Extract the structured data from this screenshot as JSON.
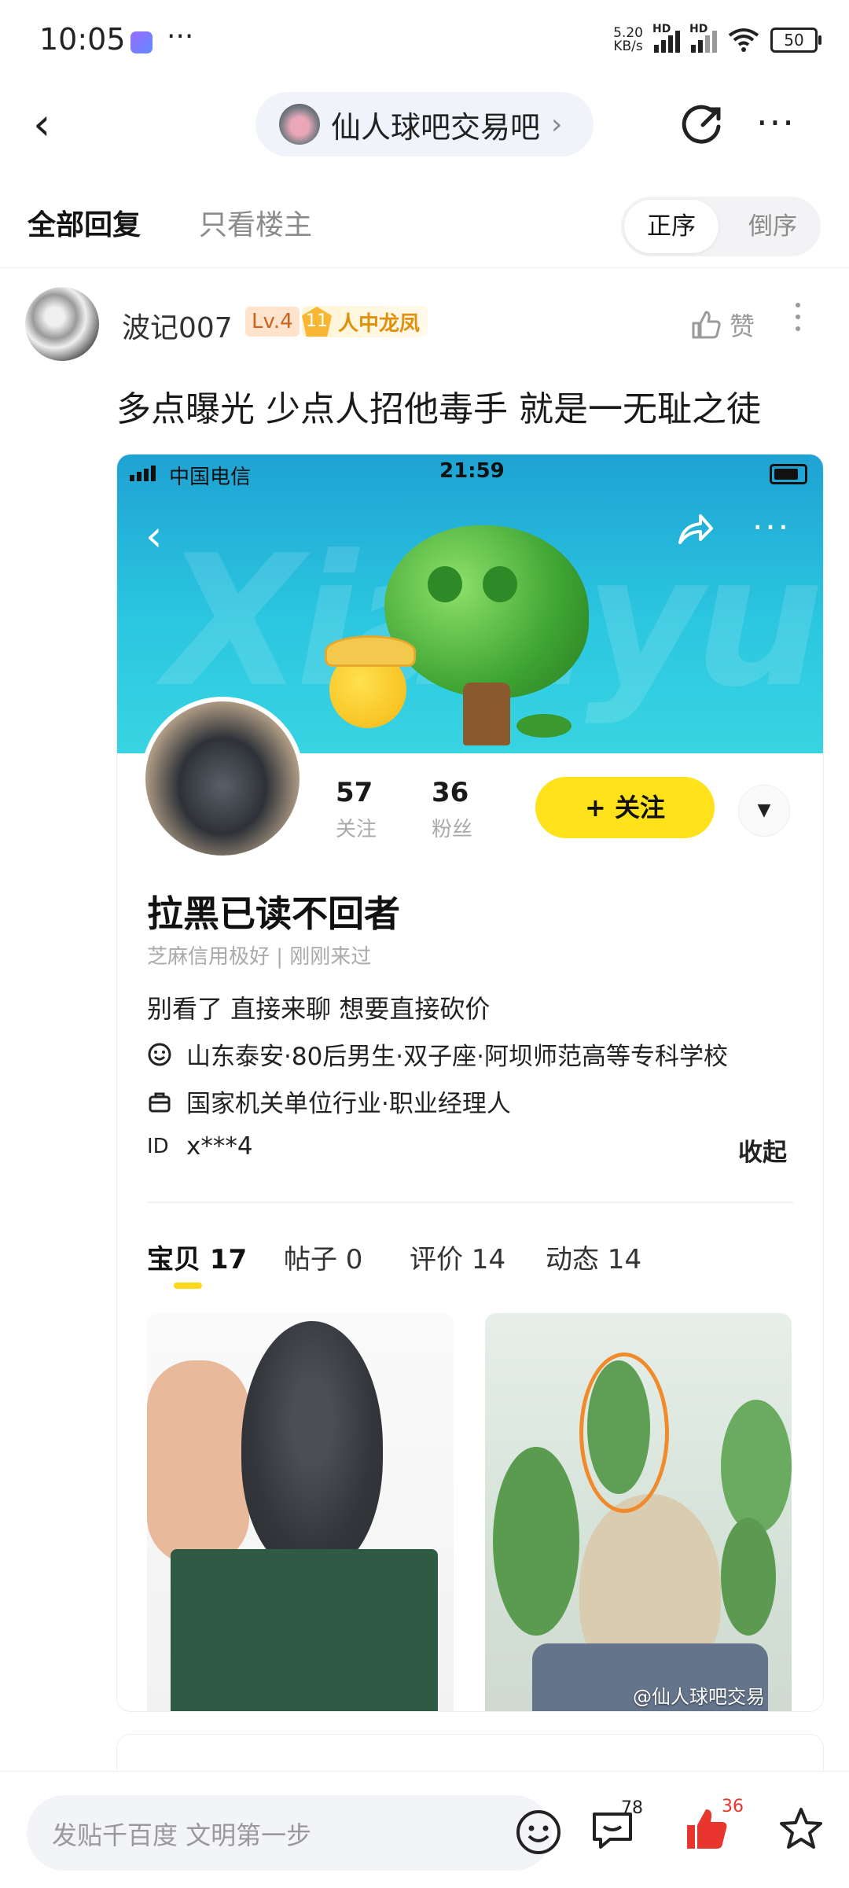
{
  "status_bar": {
    "time": "10:05",
    "net_speed": "5.20\nKB/s",
    "battery": "50"
  },
  "nav": {
    "forum_name": "仙人球吧交易吧",
    "chevron": "›"
  },
  "tabs": {
    "all_replies": "全部回复",
    "op_only": "只看楼主",
    "order_asc": "正序",
    "order_desc": "倒序"
  },
  "post": {
    "username": "波记007",
    "level": "Lv.4",
    "honor_level": "11",
    "honor_title": "人中龙凤",
    "like_label": "赞",
    "content": "多点曝光 少点人招他毒手 就是一无耻之徒"
  },
  "screenshot": {
    "carrier": "中国电信",
    "time": "21:59",
    "watermark_bg": "Xianyu",
    "following_count": "57",
    "following_label": "关注",
    "fans_count": "36",
    "fans_label": "粉丝",
    "follow_button": "+ 关注",
    "profile_name": "拉黑已读不回者",
    "credit": "芝麻信用极好 | 刚刚来过",
    "bio": "别看了 直接来聊 想要直接砍价",
    "info_location": "山东泰安·80后男生·双子座·阿坝师范高等专科学校",
    "info_job": "国家机关单位行业·职业经理人",
    "id_label": "ID",
    "id_value": "x***4",
    "collapse": "收起",
    "tabs": [
      "宝贝 17",
      "帖子 0",
      "评价 14",
      "动态 14"
    ],
    "image_watermark": "@仙人球吧交易"
  },
  "bottom_bar": {
    "reply_placeholder": "发贴千百度 文明第一步",
    "comment_count": "78",
    "like_count": "36"
  },
  "colors": {
    "accent_yellow": "#ffe21a",
    "like_red": "#e8352e",
    "honor_orange": "#e1900b"
  }
}
